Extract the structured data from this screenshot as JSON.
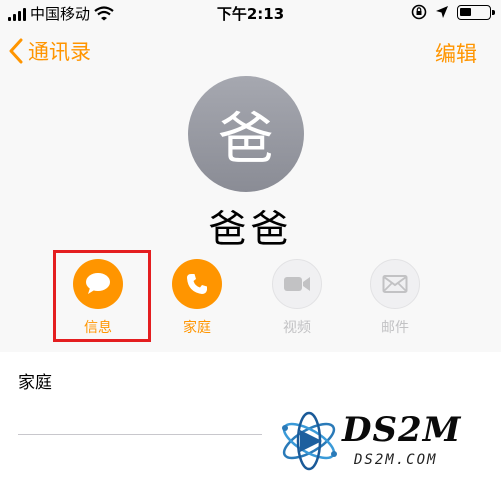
{
  "status_bar": {
    "carrier": "中国移动",
    "time": "下午2:13"
  },
  "nav": {
    "back_label": "通讯录",
    "edit_label": "编辑"
  },
  "contact": {
    "avatar_initial": "爸",
    "name": "爸爸"
  },
  "actions": [
    {
      "label": "信息",
      "icon": "message-icon",
      "enabled": true
    },
    {
      "label": "家庭",
      "icon": "phone-icon",
      "enabled": true
    },
    {
      "label": "视频",
      "icon": "video-icon",
      "enabled": false
    },
    {
      "label": "邮件",
      "icon": "mail-icon",
      "enabled": false
    }
  ],
  "phone": {
    "label": "家庭"
  },
  "watermark": {
    "title": "DS2M",
    "subtitle": "DS2M.COM"
  },
  "colors": {
    "accent": "#ff9500",
    "highlight": "#e41e20"
  }
}
